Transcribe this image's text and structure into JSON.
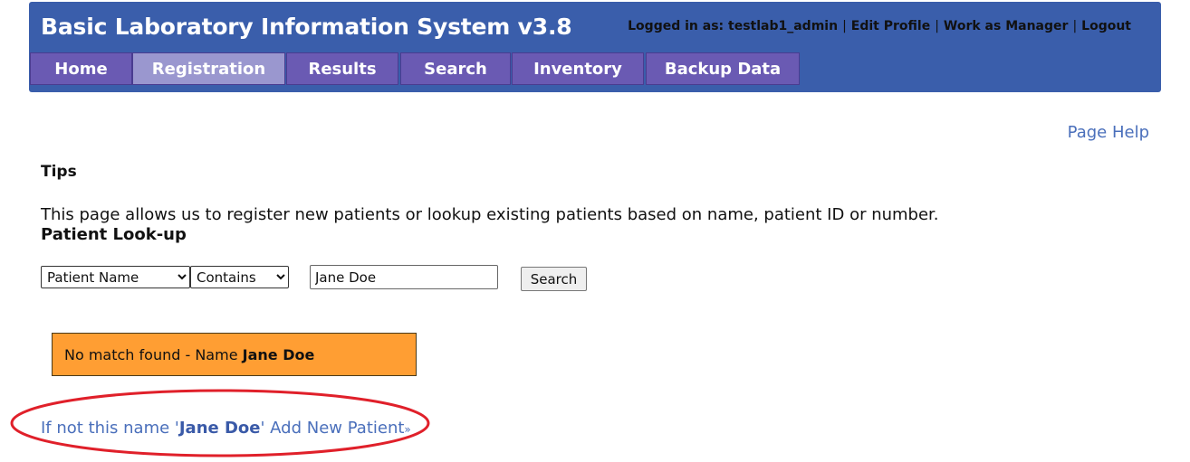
{
  "header": {
    "app_title": "Basic Laboratory Information System v3.8",
    "logged_in_label": "Logged in as: testlab1_admin",
    "edit_profile": "Edit Profile",
    "work_as_manager": "Work as Manager",
    "logout": "Logout",
    "separator": "|"
  },
  "tabs": [
    {
      "label": "Home",
      "active": false
    },
    {
      "label": "Registration",
      "active": true
    },
    {
      "label": "Results",
      "active": false
    },
    {
      "label": "Search",
      "active": false
    },
    {
      "label": "Inventory",
      "active": false
    },
    {
      "label": "Backup Data",
      "active": false
    }
  ],
  "page_help": "Page Help",
  "tips": {
    "heading": "Tips",
    "text": "This page allows us to register new patients or lookup existing patients based on name, patient ID or number."
  },
  "lookup": {
    "heading": "Patient Look-up",
    "field_select": "Patient Name",
    "match_select": "Contains",
    "query_value": "Jane Doe",
    "search_button": "Search"
  },
  "result": {
    "message_prefix": "No match found - Name",
    "name": "Jane Doe"
  },
  "add_patient": {
    "prefix": "If not this name '",
    "name": "Jane Doe",
    "suffix": "' Add New Patient",
    "arrow": "»"
  },
  "colors": {
    "header_bg": "#3a5eab",
    "tab_bg": "#6a5ab3",
    "tab_active_bg": "#9a97cf",
    "link": "#4a6fbb",
    "alert_bg": "#ff9e33",
    "annotation": "#e0202a"
  }
}
